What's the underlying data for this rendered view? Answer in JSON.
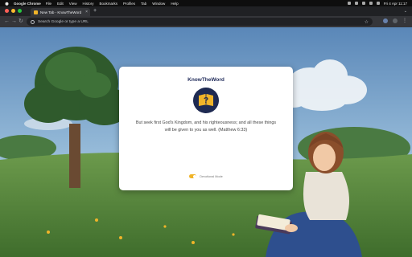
{
  "menubar": {
    "app": "Google Chrome",
    "items": [
      "File",
      "Edit",
      "View",
      "History",
      "Bookmarks",
      "Profiles",
      "Tab",
      "Window",
      "Help"
    ],
    "clock": "Fri 4 Apr  11:17"
  },
  "tab": {
    "title": "New Tab - KnowTheWord",
    "close": "×"
  },
  "newtab": "+",
  "omnibox": {
    "placeholder": "Search Google or type a URL"
  },
  "card": {
    "title": "KnowTheWord",
    "logo_mark": "?",
    "verse": "But seek first God's Kingdom, and his righteousness; and all these things will be given to you as well. (Matthew 6:33)",
    "toggle_label": "Devotional Mode",
    "toggle_on": true
  },
  "colors": {
    "accent": "#f0b429",
    "brand": "#1e2a52"
  }
}
